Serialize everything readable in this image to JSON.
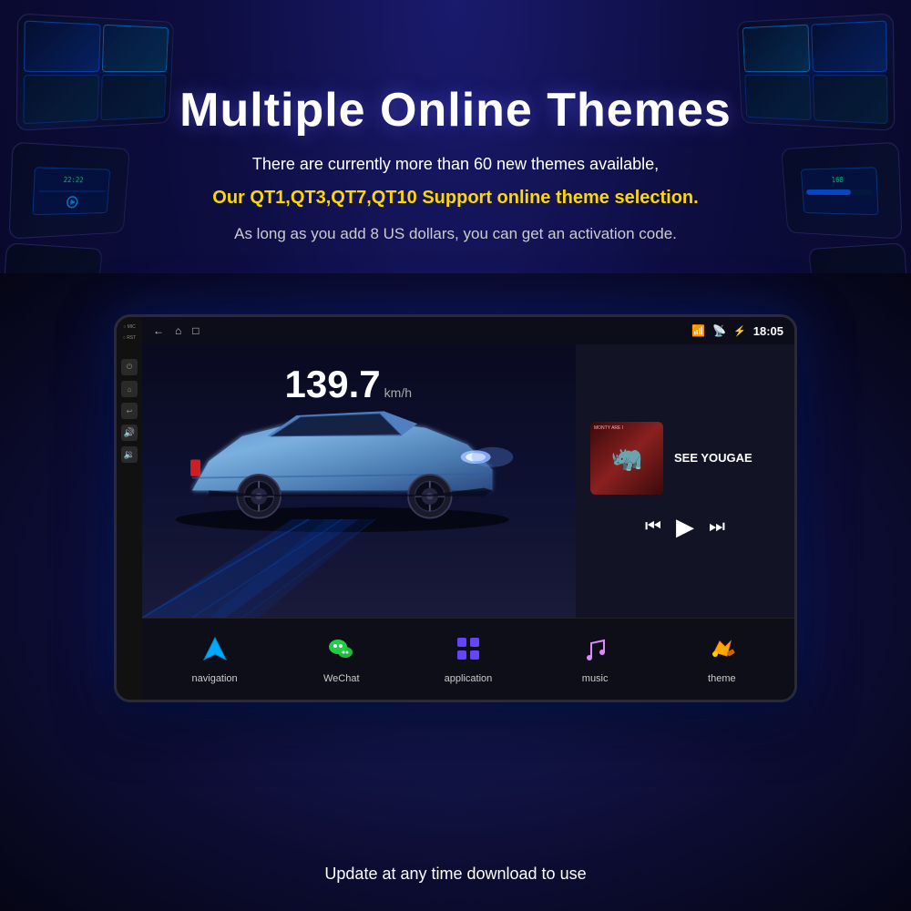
{
  "header": {
    "title": "Multiple Online Themes",
    "subtitle1": "There are currently more than 60 new themes available,",
    "subtitle2": "Our QT1,QT3,QT7,QT10 Support online theme selection.",
    "subtitle3": "As long as you add 8 US dollars, you can get an activation code."
  },
  "device": {
    "side_labels": [
      "MIC",
      "RST"
    ],
    "status_bar": {
      "time": "18:05",
      "icons": [
        "signal",
        "wifi",
        "bluetooth"
      ]
    },
    "speed": {
      "value": "139.7",
      "unit": "km/h"
    },
    "music": {
      "title": "SEE YOUGAE",
      "album_label": "MONTY ARE I"
    },
    "nav_items": [
      {
        "label": "navigation",
        "icon": "🧭"
      },
      {
        "label": "WeChat",
        "icon": "💬"
      },
      {
        "label": "application",
        "icon": "⋮⋮"
      },
      {
        "label": "music",
        "icon": "🎵"
      },
      {
        "label": "theme",
        "icon": "🔑"
      }
    ]
  },
  "footer": {
    "caption": "Update at any time download to use"
  },
  "colors": {
    "accent_yellow": "#ffd700",
    "bg_dark": "#0a0a2e",
    "screen_blue": "#0d1a4a"
  }
}
